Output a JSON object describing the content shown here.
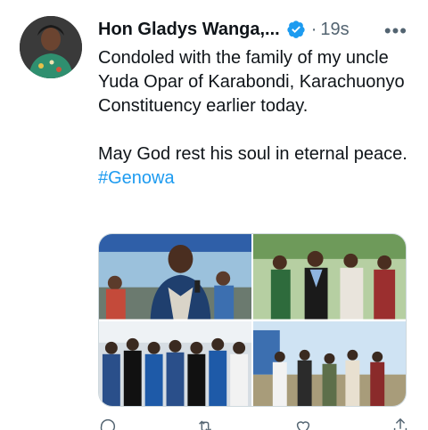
{
  "tweet": {
    "author": {
      "display_name": "Hon Gladys Wanga,...",
      "verified": true
    },
    "separator": "·",
    "timestamp": "19s",
    "text_line_1": "Condoled with the family of my uncle Yuda Opar of Karabondi, Karachuonyo Constituency earlier today.",
    "text_line_2": "May God rest his soul in eternal peace. ",
    "hashtag": "#Genowa",
    "more_icon": "more-horizontal-icon"
  },
  "media": {
    "photos": [
      {
        "icon": "photo-speaker-icon"
      },
      {
        "icon": "photo-group-icon"
      },
      {
        "icon": "photo-crowd-icon"
      },
      {
        "icon": "photo-outdoor-icon"
      }
    ]
  },
  "actions": {
    "icons": [
      "reply-icon",
      "retweet-icon",
      "like-icon",
      "share-icon"
    ]
  },
  "colors": {
    "accent": "#1d9bf0",
    "text": "#0f1419",
    "secondary": "#536471",
    "border": "#cfd9de"
  }
}
